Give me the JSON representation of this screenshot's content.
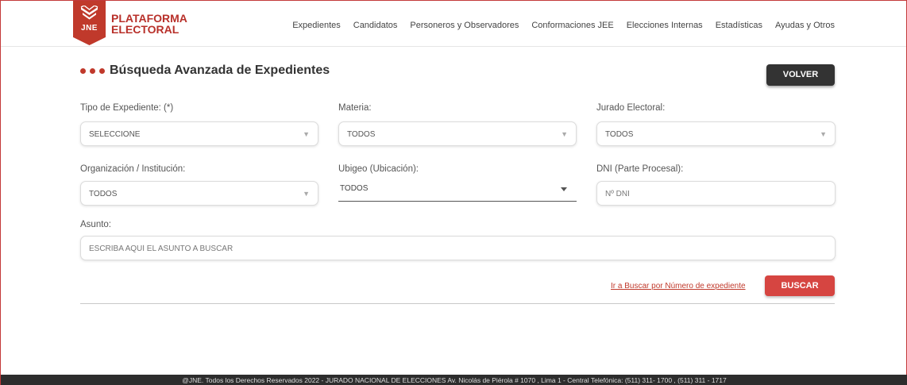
{
  "brand": {
    "line1": "PLATAFORMA",
    "line2": "ELECTORAL",
    "badge_text": "JNE",
    "accent_color": "#c0392b"
  },
  "nav": [
    "Expedientes",
    "Candidatos",
    "Personeros y Observadores",
    "Conformaciones JEE",
    "Elecciones Internas",
    "Estadísticas",
    "Ayudas y Otros"
  ],
  "page": {
    "title": "Búsqueda Avanzada de Expedientes",
    "back_label": "VOLVER"
  },
  "form": {
    "tipo": {
      "label": "Tipo de Expediente: (*)",
      "value": "SELECCIONE"
    },
    "materia": {
      "label": "Materia:",
      "value": "TODOS"
    },
    "jurado": {
      "label": "Jurado Electoral:",
      "value": "TODOS"
    },
    "organizacion": {
      "label": "Organización / Institución:",
      "value": "TODOS"
    },
    "ubigeo": {
      "label": "Ubigeo (Ubicación):",
      "value": "TODOS"
    },
    "dni": {
      "label": "DNI (Parte Procesal):",
      "placeholder": "Nº DNI"
    },
    "asunto": {
      "label": "Asunto:",
      "placeholder": "ESCRIBA AQUÍ EL ASUNTO A BUSCAR"
    }
  },
  "actions": {
    "link_label": "Ir a Buscar por Número de expediente",
    "search_label": "BUSCAR"
  },
  "footer": {
    "text": "@JNE. Todos los Derechos Reservados 2022  -  JURADO NACIONAL DE ELECCIONES Av. Nicolás de Piérola # 1070 , Lima 1 - Central Telefónica: (511) 311- 1700 , (511) 311 - 1717"
  }
}
